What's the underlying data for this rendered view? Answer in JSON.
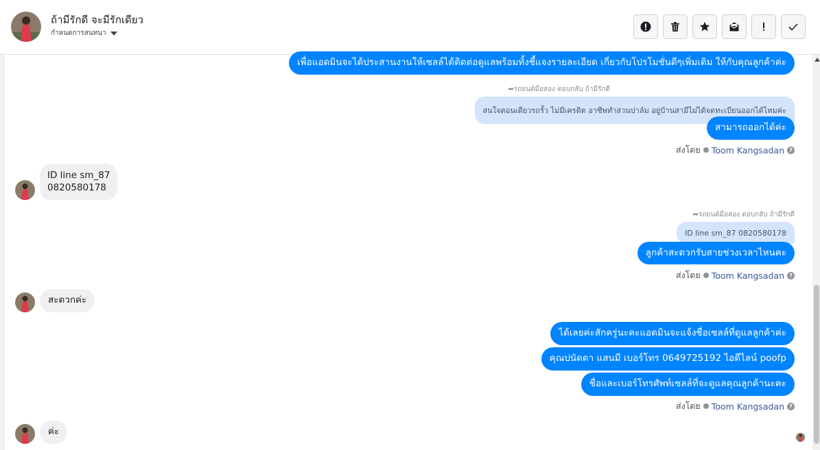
{
  "header": {
    "name": "ถ้ามีรักดี จะมีรักเดียว",
    "subtitle": "กำหนดการสนทนา",
    "actions": [
      "report-icon",
      "trash-icon",
      "star-icon",
      "mark-unread-icon",
      "important-icon",
      "done-icon"
    ]
  },
  "messages": {
    "m1": "เพื่อแอดมินจะได้ประสานงานให้เซลล์ได้ติดต่อดูแลพร้อมทั้งชี้แจงรายละเอียด เกี่ยวกับโปรโมชั่นดีๆเพิ่มเติม ให้กับคุณลูกค้าค่ะ",
    "reply1_label": "รถยนต์มือสอง ตอบกลับ ถ้ามีรักดี",
    "reply1_quote": "สนใจตอนเดียวรถรั้ว ไม่มีเครดิต อาชีพทำสวนปาล์ม อยู่บ้านสามีไม่ได้จดทะเบียนออกได้ไหมค่ะ",
    "m2": "สามารถออกได้ค่ะ",
    "sent1_prefix": "ส่งโดย",
    "sent1_name": "Toom Kangsadan",
    "in1_line1": "ID line sm_87",
    "in1_line2": "0820580178",
    "reply2_label": "รถยนต์มือสอง ตอบกลับ ถ้ามีรักดี",
    "reply2_quote": "ID line sm_87 0820580178",
    "m3": "ลูกค้าสะดวกรับสายช่วงเวลาไหนคะ",
    "sent2_prefix": "ส่งโดย",
    "sent2_name": "Toom Kangsadan",
    "in2": "สะดวกค่ะ",
    "m4": "ได้เลยค่ะสักครู่นะคะแอดมินจะแจ้งชื่อเซลล์ที่ดูแลลูกค้าค่ะ",
    "m5": "คุณปนัดดา แสนมี   เบอร์โทร 0649725192  ไอดีไลน์ poofp",
    "m6": "ชื่อและเบอร์โทรศัพท์เซลล์ที่จะดูแลคุณลูกค้านะคะ",
    "sent3_prefix": "ส่งโดย",
    "sent3_name": "Toom Kangsadan",
    "in3": "ค่ะ"
  },
  "colors": {
    "outgoing": "#0084ff",
    "incoming": "#f0f0f0",
    "quote": "#d3e4fb"
  }
}
